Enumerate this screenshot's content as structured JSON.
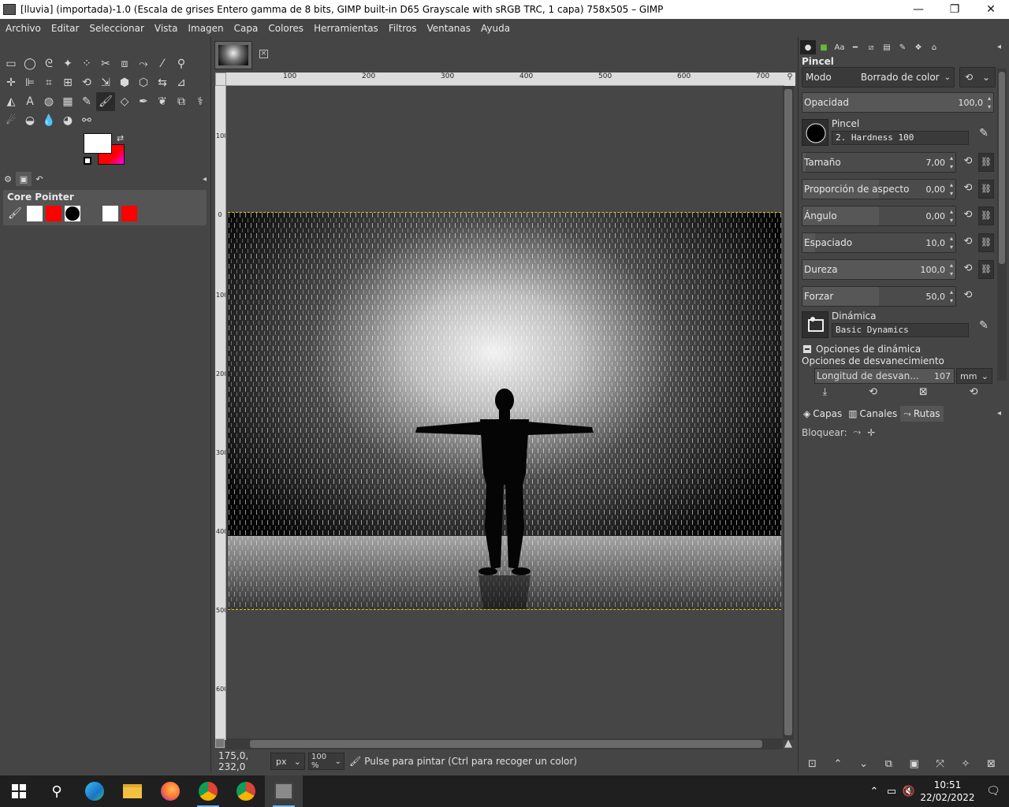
{
  "titlebar": {
    "title": "[lluvia] (importada)-1.0 (Escala de grises Entero gamma de 8 bits, GIMP built-in D65 Grayscale with sRGB TRC, 1 capa) 758x505 – GIMP",
    "minimize": "—",
    "maximize": "❐",
    "close": "✕"
  },
  "menubar": [
    "Archivo",
    "Editar",
    "Seleccionar",
    "Vista",
    "Imagen",
    "Capa",
    "Colores",
    "Herramientas",
    "Filtros",
    "Ventanas",
    "Ayuda"
  ],
  "core_pointer": {
    "title": "Core Pointer"
  },
  "ruler": {
    "h_ticks": [
      "100",
      "200",
      "300",
      "400",
      "500",
      "600",
      "700"
    ],
    "v_ticks": [
      "100",
      "0",
      "100",
      "200",
      "300",
      "400",
      "500",
      "600"
    ]
  },
  "statusbar": {
    "coords": "175,0, 232,0",
    "unit": "px",
    "zoom": "100 %",
    "hint": "Pulse para pintar (Ctrl para recoger un color)"
  },
  "tool_options": {
    "title": "Pincel",
    "mode_label": "Modo",
    "mode_value": "Borrado de color",
    "opacity_label": "Opacidad",
    "opacity_value": "100,0",
    "opacity_level": 1.0,
    "brush_label": "Pincel",
    "brush_value": "2. Hardness 100",
    "params": [
      {
        "label": "Tamaño",
        "value": "7,00",
        "level": 0.02
      },
      {
        "label": "Proporción de aspecto",
        "value": "0,00",
        "level": 0.5
      },
      {
        "label": "Ángulo",
        "value": "0,00",
        "level": 0.5
      },
      {
        "label": "Espaciado",
        "value": "10,0",
        "level": 0.08
      },
      {
        "label": "Dureza",
        "value": "100,0",
        "level": 1.0
      },
      {
        "label": "Forzar",
        "value": "50,0",
        "level": 0.5
      }
    ],
    "dynamics_label": "Dinámica",
    "dynamics_value": "Basic Dynamics",
    "dynamics_options": "Opciones de dinámica",
    "fade_options": "Opciones de desvanecimiento",
    "fade_length_label": "Longitud de desvan...",
    "fade_length_value": "107",
    "fade_unit": "mm"
  },
  "layers_dock": {
    "tabs": [
      "Capas",
      "Canales",
      "Rutas"
    ],
    "lock_label": "Bloquear:"
  },
  "taskbar": {
    "time": "10:51",
    "date": "22/02/2022"
  },
  "colors": {
    "foreground": "#ffffff",
    "background": "#ff0000",
    "accent": "#e0c400"
  }
}
